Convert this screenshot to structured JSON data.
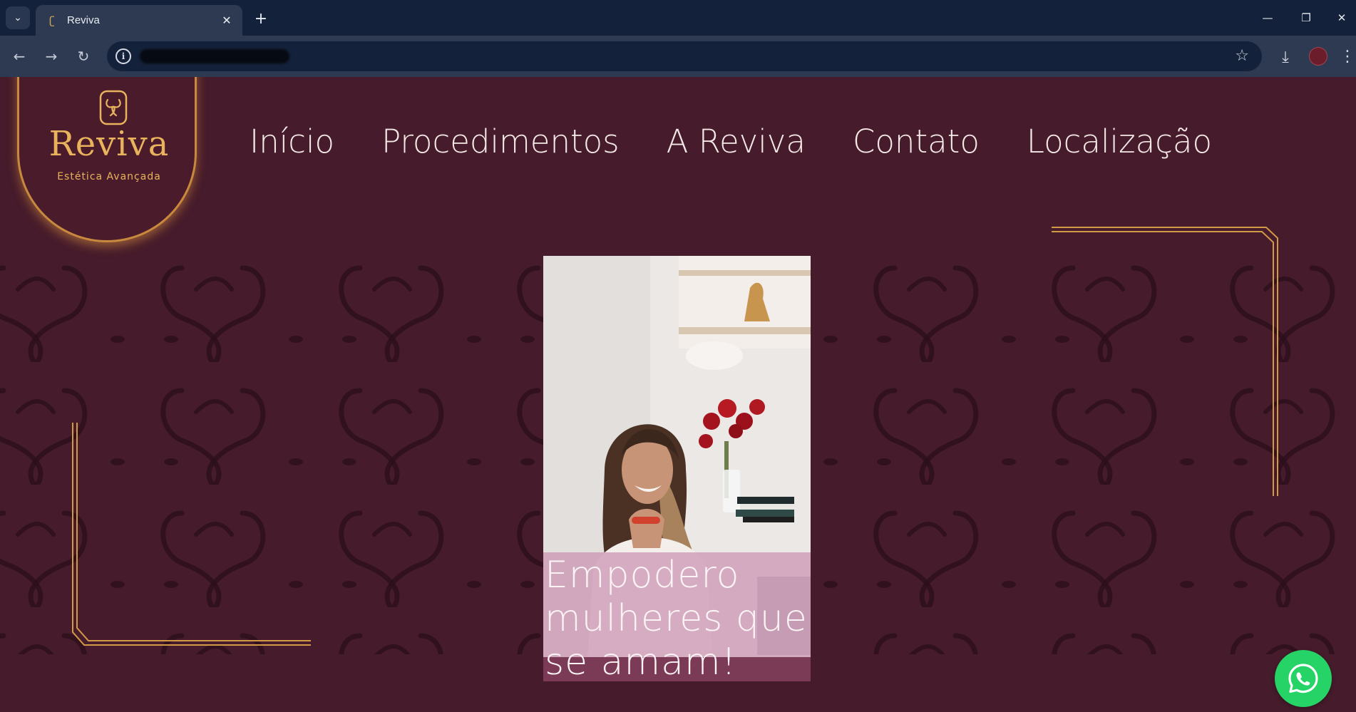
{
  "browser": {
    "tab_title": "Reviva",
    "tab_close_glyph": "✕",
    "new_tab_glyph": "+",
    "window_controls": {
      "minimize": "—",
      "restore": "❐",
      "close": "✕"
    },
    "icons": [
      "tab-list-icon",
      "back-icon",
      "forward-icon",
      "reload-icon",
      "site-info-icon",
      "star-icon",
      "download-icon",
      "profile-avatar",
      "menu-icon"
    ]
  },
  "site": {
    "logo": {
      "name": "Reviva",
      "tagline": "Estética Avançada"
    },
    "nav": [
      "Início",
      "Procedimentos",
      "A Reviva",
      "Contato",
      "Localização"
    ],
    "hero": {
      "caption_lines": [
        "Empodero",
        "mulheres que",
        "se amam!"
      ]
    },
    "colors": {
      "background": "#461b2b",
      "gold": "#e8b35c",
      "caption_overlay": "#c992b2",
      "whatsapp": "#25d366"
    }
  }
}
